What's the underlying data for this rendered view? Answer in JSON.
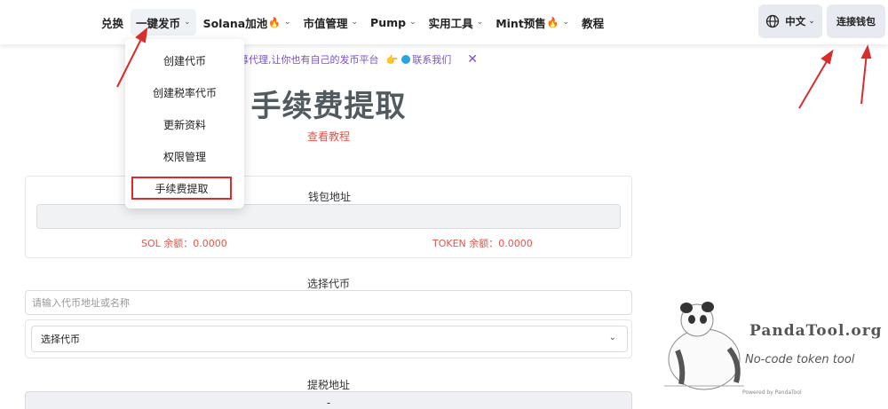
{
  "nav": {
    "items": [
      {
        "label": "兑换",
        "dropdown": false,
        "hot": false
      },
      {
        "label": "一键发币",
        "dropdown": true,
        "hot": false,
        "active": true
      },
      {
        "label": "Solana加池",
        "dropdown": true,
        "hot": true
      },
      {
        "label": "市值管理",
        "dropdown": true,
        "hot": false
      },
      {
        "label": "Pump",
        "dropdown": true,
        "hot": false
      },
      {
        "label": "实用工具",
        "dropdown": true,
        "hot": false
      },
      {
        "label": "Mint预售",
        "dropdown": true,
        "hot": true
      },
      {
        "label": "教程",
        "dropdown": false,
        "hot": false
      }
    ],
    "language_label": "中文",
    "connect_label": "连接钱包"
  },
  "dropdown_menu": {
    "items": [
      {
        "label": "创建代币"
      },
      {
        "label": "创建税率代币"
      },
      {
        "label": "更新资料"
      },
      {
        "label": "权限管理"
      },
      {
        "label": "手续费提取",
        "highlighted": true
      }
    ]
  },
  "announcement": {
    "message": "招募代理,让你也有自己的发币平台",
    "contact": "联系我们"
  },
  "page": {
    "title": "手续费提取",
    "tutorial_link": "查看教程"
  },
  "wallet": {
    "label": "钱包地址",
    "sol_balance_label": "SOL 余额：",
    "sol_balance": "0.0000",
    "token_balance_label": "TOKEN 余额：",
    "token_balance": "0.0000"
  },
  "token_select": {
    "label": "选择代币",
    "search_placeholder": "请输入代币地址或名称",
    "selected": "选择代币"
  },
  "tax_address": {
    "label": "提税地址",
    "value": "-"
  },
  "watermark": {
    "brand": "PandaTool.org",
    "tagline": "No-code token tool",
    "powered": "Powered by PandaTool"
  },
  "colors": {
    "accent_red": "#e0554c",
    "highlight_border": "#d92c2c",
    "announcement_purple": "#7a4fd1",
    "button_bg": "#e7ebf1"
  }
}
